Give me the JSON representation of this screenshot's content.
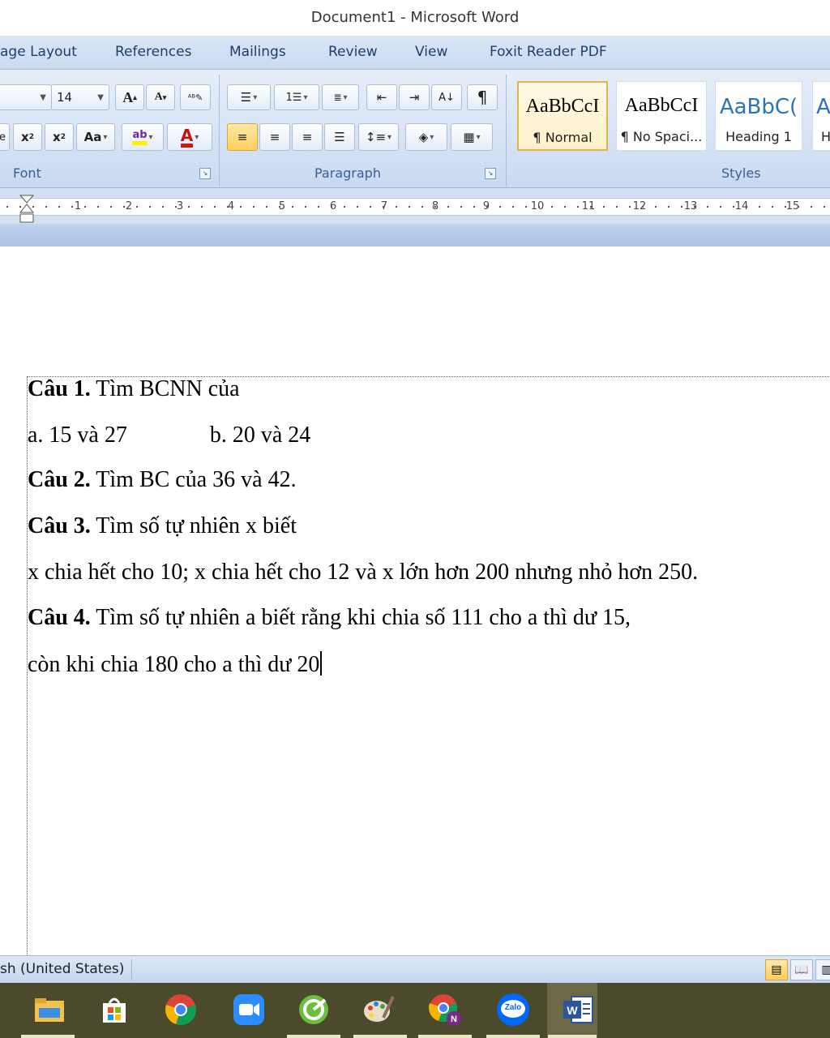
{
  "window": {
    "title": "Document1 - Microsoft Word"
  },
  "tabs": [
    "age Layout",
    "References",
    "Mailings",
    "Review",
    "View",
    "Foxit Reader PDF"
  ],
  "font_group": {
    "font_size": "14",
    "label": "Font"
  },
  "paragraph_group": {
    "label": "Paragraph"
  },
  "styles_group": {
    "label": "Styles",
    "items": [
      {
        "sample": "AaBbCcI",
        "name": "¶ Normal",
        "selected": true
      },
      {
        "sample": "AaBbCcI",
        "name": "¶ No Spaci..."
      },
      {
        "sample": "AaBbC(",
        "name": "Heading 1"
      },
      {
        "sample": "A",
        "name": "H"
      }
    ]
  },
  "ruler": {
    "numbers": [
      "1",
      "2",
      "3",
      "4",
      "5",
      "6",
      "7",
      "8",
      "9",
      "10",
      "11",
      "12",
      "13",
      "14",
      "15"
    ]
  },
  "document": {
    "lines": [
      {
        "bold": "Câu 1.",
        "text": " Tìm BCNN của"
      },
      {
        "bold": "",
        "text": "a. 15 và 27",
        "extra": "b. 20 và 24"
      },
      {
        "bold": "Câu 2.",
        "text": " Tìm BC của 36 và 42."
      },
      {
        "bold": "Câu 3.",
        "text": " Tìm số tự nhiên x biết"
      },
      {
        "bold": "",
        "text": "x chia hết cho 10; x chia hết cho 12 và x lớn hơn 200 nhưng nhỏ hơn 250."
      },
      {
        "bold": "Câu 4.",
        "text": " Tìm số tự nhiên a biết rằng khi chia số 111 cho a thì dư 15,"
      },
      {
        "bold": "",
        "text": "còn khi chia 180 cho a thì dư 20"
      }
    ]
  },
  "status": {
    "language": "sh (United States)"
  },
  "taskbar": {
    "apps": [
      "file-explorer-icon",
      "store-icon",
      "chrome-icon",
      "zoom-icon",
      "greenshot-icon",
      "paint-icon",
      "chrome-profile-icon",
      "zalo-icon",
      "word-icon"
    ],
    "zalo_label": "Zalo"
  },
  "colors": {
    "ribbon": "#d6e3f5",
    "taskbar": "#4b4a2d",
    "accent": "#ffcf5a"
  }
}
